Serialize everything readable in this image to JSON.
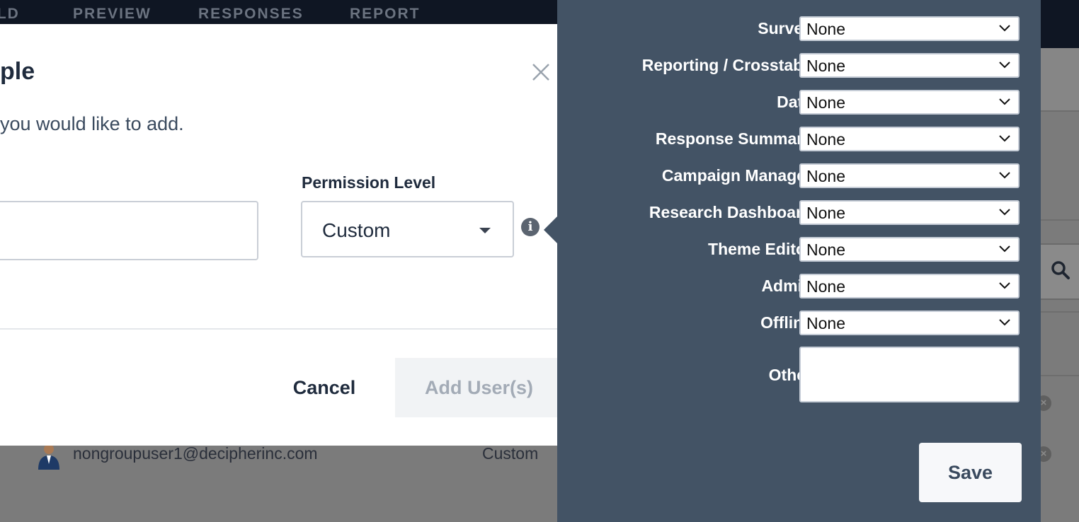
{
  "top_nav": {
    "items": [
      {
        "label": "ILD"
      },
      {
        "label": "PREVIEW"
      },
      {
        "label": "RESPONSES"
      },
      {
        "label": "REPORT"
      }
    ]
  },
  "modal": {
    "title": "ple",
    "instruction": "you would like to add.",
    "permission_level_label": "Permission Level",
    "permission_level_value": "Custom",
    "cancel_label": "Cancel",
    "add_label": "Add User(s)"
  },
  "background_user": {
    "email": "nongroupuser1@decipherinc.com",
    "permission": "Custom"
  },
  "permissions_panel": {
    "rows": [
      {
        "label": "Survey",
        "value": "None"
      },
      {
        "label": "Reporting / Crosstabs",
        "value": "None"
      },
      {
        "label": "Data",
        "value": "None"
      },
      {
        "label": "Response Summary",
        "value": "None"
      },
      {
        "label": "Campaign Manager",
        "value": "None"
      },
      {
        "label": "Research Dashboard",
        "value": "None"
      },
      {
        "label": "Theme Editor",
        "value": "None"
      },
      {
        "label": "Admin",
        "value": "None"
      },
      {
        "label": "Offline",
        "value": "None"
      }
    ],
    "other_label": "Other",
    "other_value": "",
    "save_label": "Save"
  },
  "colors": {
    "nav_bg": "#0f1623",
    "panel_bg": "#435365",
    "modal_bg": "#ffffff",
    "text_dark": "#1f2b3d"
  }
}
